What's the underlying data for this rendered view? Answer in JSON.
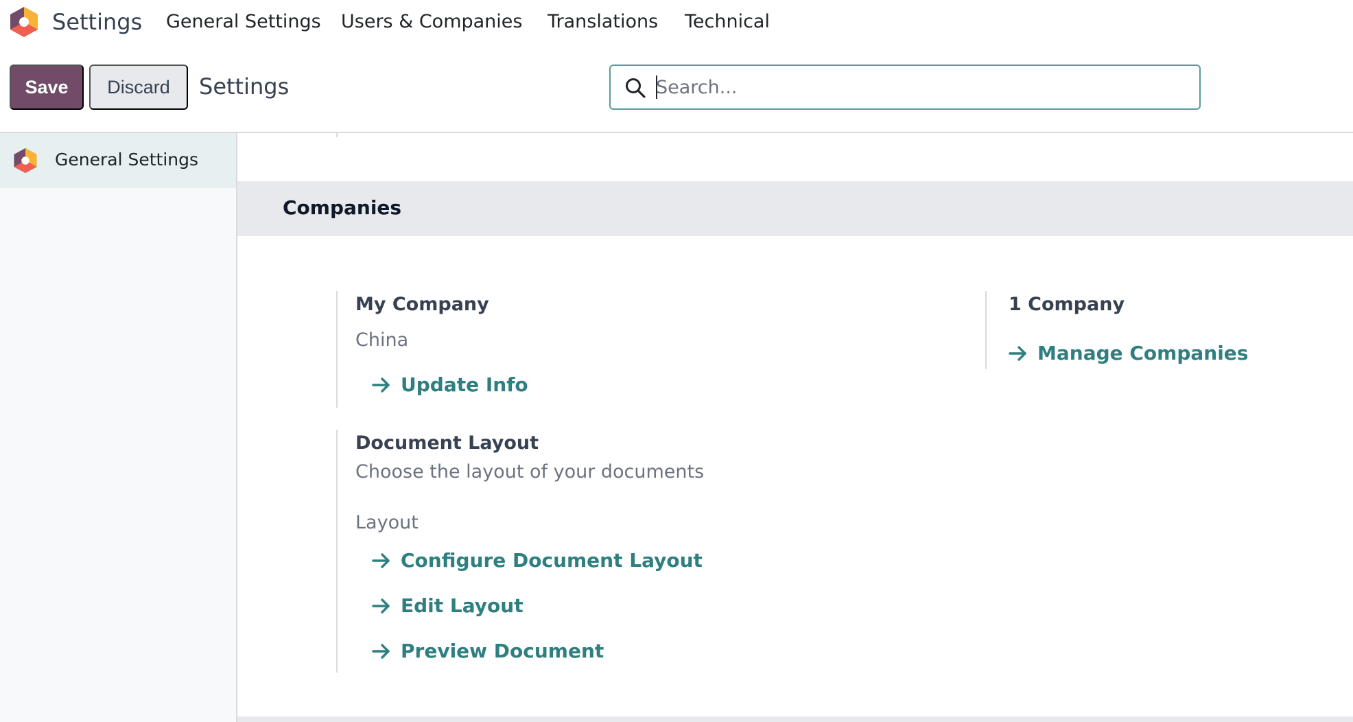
{
  "navbar": {
    "app_title": "Settings",
    "menu": [
      "General Settings",
      "Users & Companies",
      "Translations",
      "Technical"
    ]
  },
  "control_panel": {
    "save_label": "Save",
    "discard_label": "Discard",
    "breadcrumb": "Settings",
    "search": {
      "placeholder": "Search...",
      "value": ""
    }
  },
  "sidebar": {
    "items": [
      {
        "label": "General Settings",
        "icon": "odoo-logo-icon",
        "active": true
      }
    ]
  },
  "section": {
    "title": "Companies",
    "company": {
      "name": "My Company",
      "country": "China",
      "update_link": "Update Info"
    },
    "companies_count": {
      "label": "1 Company",
      "manage_link": "Manage Companies"
    },
    "document_layout": {
      "title": "Document Layout",
      "description": "Choose the layout of your documents",
      "layout_label": "Layout",
      "links": [
        "Configure Document Layout",
        "Edit Layout",
        "Preview Document"
      ]
    }
  },
  "colors": {
    "primary": "#714B67",
    "link": "#2f7f80",
    "logo_purple": "#714B67",
    "logo_orange": "#F06050",
    "logo_yellow": "#F9B234"
  }
}
